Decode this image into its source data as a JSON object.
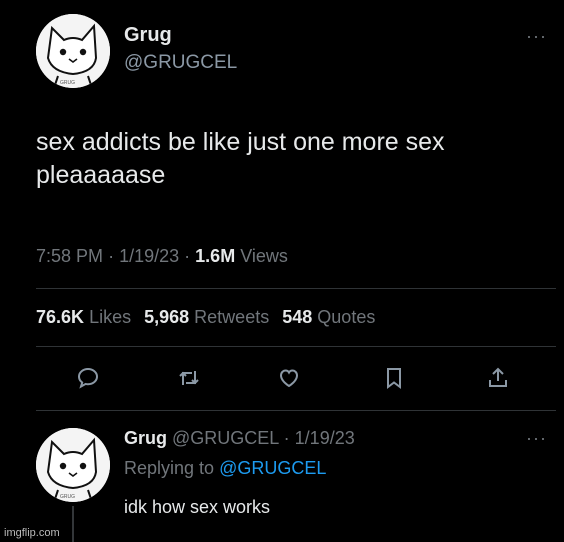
{
  "main_tweet": {
    "name": "Grug",
    "handle": "@GRUGCEL",
    "avatar_signature": "GRUG",
    "more": "···",
    "text_line1": "sex addicts be like just one more sex",
    "text_line2": "pleaaaaase",
    "time": "7:58 PM",
    "sep1": "·",
    "date": "1/19/23",
    "sep2": "·",
    "views_count": "1.6M",
    "views_label": "Views",
    "likes_count": "76.6K",
    "likes_label": "Likes",
    "retweets_count": "5,968",
    "retweets_label": "Retweets",
    "quotes_count": "548",
    "quotes_label": "Quotes"
  },
  "actions": [
    "reply-icon",
    "retweet-icon",
    "like-icon",
    "bookmark-icon",
    "share-icon"
  ],
  "reply_tweet": {
    "name": "Grug",
    "handle": "@GRUGCEL",
    "sep": "·",
    "date": "1/19/23",
    "more": "···",
    "replying_prefix": "Replying to",
    "replying_to": "@GRUGCEL",
    "text": "idk how sex works"
  },
  "watermark": "imgflip.com",
  "colors": {
    "background": "#000000",
    "text": "#e7e9ea",
    "secondary": "#71767b",
    "link": "#1d9bf0",
    "divider": "#2f3336"
  }
}
